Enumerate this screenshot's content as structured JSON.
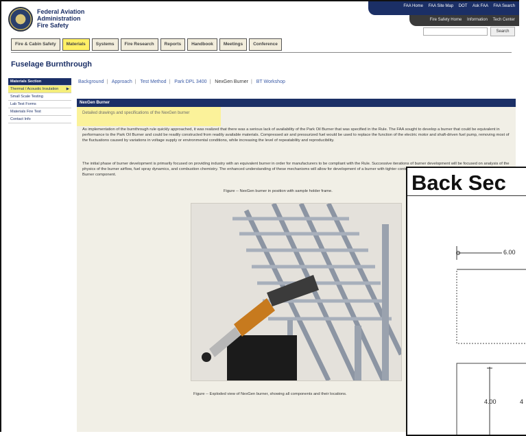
{
  "header": {
    "agency_lines": [
      "Federal Aviation",
      "Administration",
      "Fire Safety"
    ],
    "top_links": [
      "FAA Home",
      "FAA Site Map",
      "DOT",
      "Ask FAA",
      "FAA Search"
    ],
    "sub_links": [
      "Fire Safety Home",
      "Information",
      "Tech Center"
    ],
    "search_placeholder": "",
    "search_button": "Search"
  },
  "tabs": [
    {
      "label": "Fire & Cabin Safety",
      "active": false
    },
    {
      "label": "Materials",
      "active": true
    },
    {
      "label": "Systems",
      "active": false
    },
    {
      "label": "Fire Research",
      "active": false
    },
    {
      "label": "Reports",
      "active": false
    },
    {
      "label": "Handbook",
      "active": false
    },
    {
      "label": "Meetings",
      "active": false
    },
    {
      "label": "Conference",
      "active": false
    }
  ],
  "page_title": "Fuselage Burnthrough",
  "sidebar": [
    {
      "label": "Materials Section",
      "type": "head"
    },
    {
      "label": "Thermal / Acoustic Insulation",
      "type": "hl",
      "arrow": "▶"
    },
    {
      "label": "Small Scale Testing",
      "type": "normal"
    },
    {
      "label": "Lab Test Forms",
      "type": "normal"
    },
    {
      "label": "Materials Fire Test",
      "type": "normal"
    },
    {
      "label": "Contact Info",
      "type": "normal"
    }
  ],
  "subtabs": [
    {
      "label": "Background",
      "current": false
    },
    {
      "label": "Approach",
      "current": false
    },
    {
      "label": "Test Method",
      "current": false
    },
    {
      "label": "Park DPL 3400",
      "current": false
    },
    {
      "label": "NexGen Burner",
      "current": true
    },
    {
      "label": "BT Workshop",
      "current": false
    }
  ],
  "content": {
    "heading": "NexGen Burner",
    "note": "Detailed drawings and specifications of the NexGen burner",
    "paragraph1": "As implementation of the burnthrough rule quickly approached, it was realized that there was a serious lack of availability of the Park Oil Burner that was specified in the Rule. The FAA sought to develop a burner that could be equivalent in performance to the Park Oil Burner and could be readily constructed from readily available materials. Compressed air and pressurized fuel would be used to replace the function of the electric motor and shaft-driven fuel pump, removing most of the fluctuations caused by variations in voltage supply or environmental conditions, while increasing the level of repeatability and reproducibility.",
    "paragraph2": "The initial phase of burner development is primarily focused on providing industry with an equivalent burner in order for manufacturers to be compliant with the Rule. Successive iterations of burner development will be focused on analysis of the physics of the burner airflow, fuel spray dynamics, and combustion chemistry. The enhanced understanding of these mechanisms will allow for development of a burner with tighter control of the flame and will be independent of the Park Oil Burner component.",
    "caption1": "Figure -- NexGen burner in position with sample holder frame.",
    "caption2": "Figure -- Exploded view of NexGen burner, showing all components and their locations."
  },
  "overlay": {
    "title": "Back Sec",
    "dim_top": "6.00",
    "dim_left": "4.00",
    "dim_right": "4"
  }
}
